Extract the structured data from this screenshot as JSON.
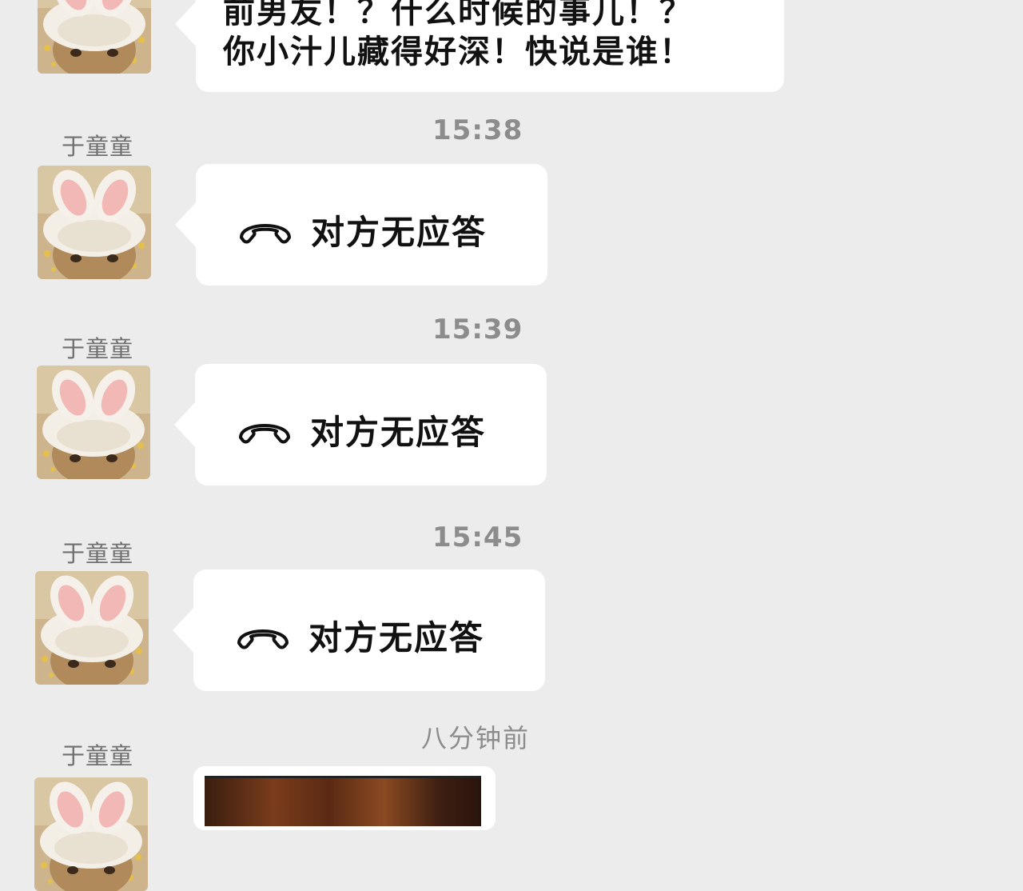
{
  "contact": {
    "name": "于童童"
  },
  "first_message": {
    "lines": [
      "前男友！？什么时候的事儿！？",
      "你小汁儿藏得好深！快说是谁！"
    ]
  },
  "call_entries": [
    {
      "time": "15:38",
      "sender": "于童童",
      "status": "对方无应答"
    },
    {
      "time": "15:39",
      "sender": "于童童",
      "status": "对方无应答"
    },
    {
      "time": "15:45",
      "sender": "于童童",
      "status": "对方无应答"
    }
  ],
  "last_entry": {
    "time": "八分钟前",
    "sender": "于童童"
  },
  "icons": {
    "call": "hang-up-phone-icon",
    "avatar": "bunny-ears-rabbit-avatar"
  },
  "colors": {
    "background": "#ececec",
    "bubble": "#ffffff",
    "muted_text": "#8c8c8c"
  }
}
